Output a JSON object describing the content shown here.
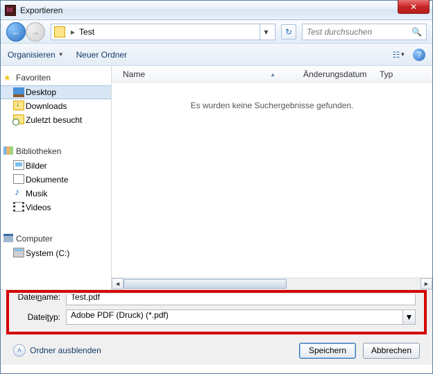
{
  "window": {
    "title": "Exportieren"
  },
  "nav": {
    "path_segment": "Test",
    "search_placeholder": "Test durchsuchen"
  },
  "toolbar": {
    "organize": "Organisieren",
    "new_folder": "Neuer Ordner"
  },
  "sidebar": {
    "favorites_label": "Favoriten",
    "favorites": [
      {
        "label": "Desktop",
        "icon": "desktop"
      },
      {
        "label": "Downloads",
        "icon": "dl"
      },
      {
        "label": "Zuletzt besucht",
        "icon": "recent"
      }
    ],
    "libraries_label": "Bibliotheken",
    "libraries": [
      {
        "label": "Bilder",
        "icon": "pic"
      },
      {
        "label": "Dokumente",
        "icon": "doc"
      },
      {
        "label": "Musik",
        "icon": "music"
      },
      {
        "label": "Videos",
        "icon": "vid"
      }
    ],
    "computer_label": "Computer",
    "drives": [
      {
        "label": "System (C:)",
        "icon": "drive"
      }
    ]
  },
  "columns": {
    "name": "Name",
    "modified": "Änderungsdatum",
    "type": "Typ"
  },
  "files": {
    "empty_message": "Es wurden keine Suchergebnisse gefunden."
  },
  "fields": {
    "filename_label_pre": "Datei",
    "filename_label_ul": "n",
    "filename_label_post": "ame:",
    "filename_value": "Test.pdf",
    "filetype_label_pre": "Datei",
    "filetype_label_ul": "t",
    "filetype_label_post": "yp:",
    "filetype_value": "Adobe PDF (Druck) (*.pdf)"
  },
  "footer": {
    "hide_folders": "Ordner ausblenden",
    "save": "Speichern",
    "cancel": "Abbrechen"
  }
}
